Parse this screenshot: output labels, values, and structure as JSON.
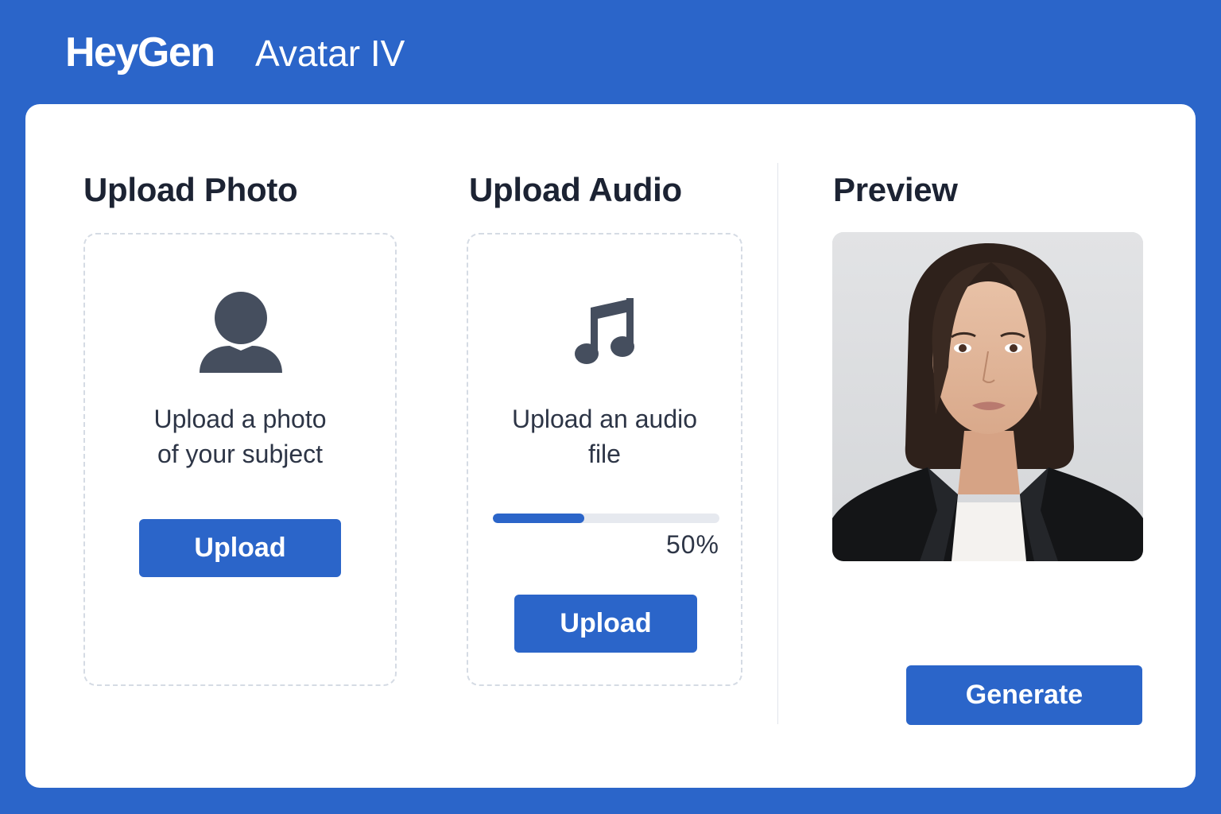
{
  "header": {
    "brand": "HeyGen",
    "product": "Avatar IV"
  },
  "photo": {
    "title": "Upload Photo",
    "icon": "person-icon",
    "description_line1": "Upload a photo",
    "description_line2": "of your subject",
    "button": "Upload"
  },
  "audio": {
    "title": "Upload Audio",
    "icon": "music-note-icon",
    "description_line1": "Upload an audio",
    "description_line2": "file",
    "progress": 0.5,
    "progress_label": "50%",
    "button": "Upload"
  },
  "preview": {
    "title": "Preview",
    "image": "portrait-photo"
  },
  "actions": {
    "generate": "Generate"
  },
  "colors": {
    "accent": "#2b65c9",
    "icon": "#454e5e",
    "text": "#1c2333"
  }
}
